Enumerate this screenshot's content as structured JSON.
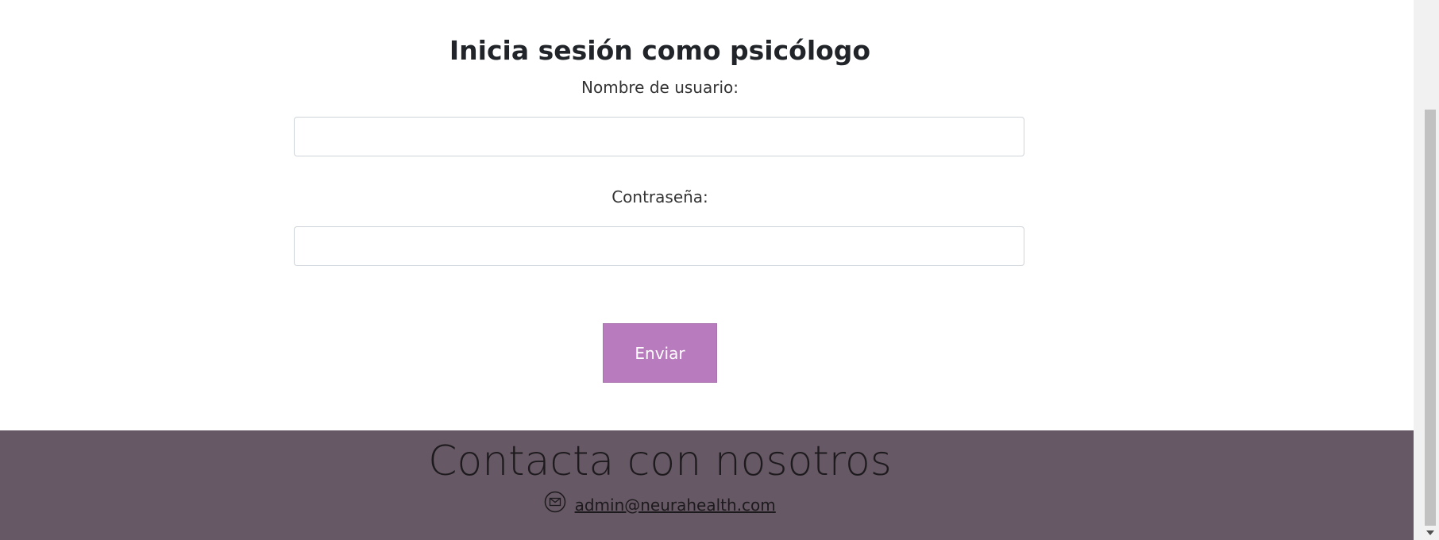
{
  "login": {
    "title": "Inicia sesión como psicólogo",
    "username_label": "Nombre de usuario:",
    "username_value": "",
    "password_label": "Contraseña:",
    "password_value": "",
    "submit_label": "Enviar"
  },
  "footer": {
    "title": "Contacta con nosotros",
    "email": "admin@neurahealth.com",
    "email_icon": "mail-icon"
  },
  "colors": {
    "button": "#b87bbd",
    "footer_bg": "#665864"
  }
}
